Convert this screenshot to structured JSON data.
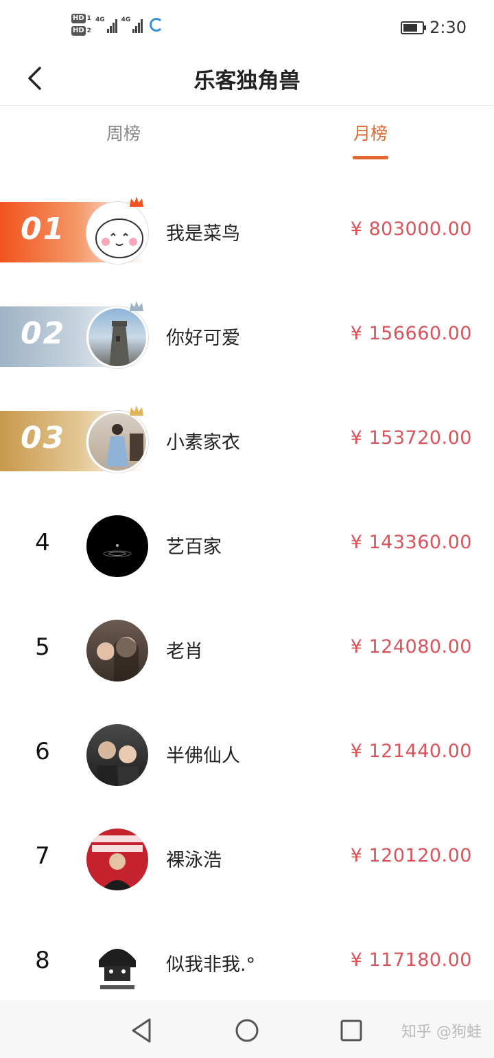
{
  "status_bar": {
    "sim1": "HD",
    "sim1_index": "1",
    "sim2": "HD",
    "sim2_index": "2",
    "net1": "4G",
    "net2": "4G",
    "time": "2:30",
    "battery_level": 0.75
  },
  "header": {
    "title": "乐客独角兽",
    "back_icon": "chevron-left-icon"
  },
  "tabs": [
    {
      "label": "周榜",
      "active": false
    },
    {
      "label": "月榜",
      "active": true
    }
  ],
  "ranking": [
    {
      "rank": "01",
      "name": "我是菜鸟",
      "amount": "¥ 803000.00"
    },
    {
      "rank": "02",
      "name": "你好可爱",
      "amount": "¥ 156660.00"
    },
    {
      "rank": "03",
      "name": "小素家衣",
      "amount": "¥ 153720.00"
    },
    {
      "rank": "4",
      "name": "艺百家",
      "amount": "¥ 143360.00"
    },
    {
      "rank": "5",
      "name": "老肖",
      "amount": "¥ 124080.00"
    },
    {
      "rank": "6",
      "name": "半佛仙人",
      "amount": "¥ 121440.00"
    },
    {
      "rank": "7",
      "name": "裸泳浩",
      "amount": "¥ 120120.00"
    },
    {
      "rank": "8",
      "name": "似我非我.°",
      "amount": "¥ 117180.00"
    }
  ],
  "navbar": {
    "back_icon": "triangle-back-icon",
    "home_icon": "circle-home-icon",
    "recent_icon": "square-recents-icon",
    "watermark": "知乎 @狗蛙"
  },
  "colors": {
    "accent": "#e0672e",
    "amount": "#d9535b",
    "rank1": "#f0531e",
    "rank2": "#9fb3c6",
    "rank3": "#c8994d"
  }
}
